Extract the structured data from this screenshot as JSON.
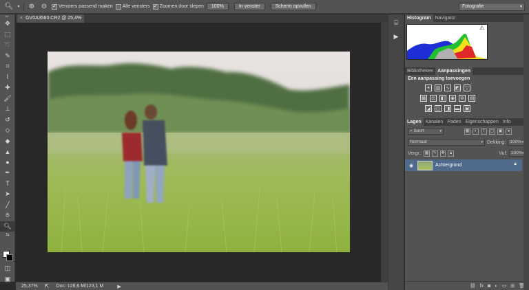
{
  "options_bar": {
    "tool_icons": [
      "zoom-icon",
      "zoom-in-icon",
      "zoom-out-icon"
    ],
    "resize_windows_label": "Vensters passend maken",
    "resize_windows_checked": true,
    "all_windows_label": "Alle vensters",
    "all_windows_checked": false,
    "scrubby_zoom_label": "Zoomen door slepen",
    "scrubby_zoom_checked": true,
    "btn_100": "100%",
    "btn_fit": "In venster",
    "btn_fill": "Scherm opvullen",
    "workspace": "Fotografie"
  },
  "document": {
    "tab_title": "GV0A3560.CR2 @ 25,4%",
    "close_glyph": "×"
  },
  "status": {
    "zoom": "25,37%",
    "doc_info": "Doc: 126,6 M/123,1 M"
  },
  "panels": {
    "histogram_tab": "Histogram",
    "navigator_tab": "Navigator",
    "libraries_tab": "Bibliotheken",
    "adjustments_tab": "Aanpassingen",
    "adjustments_title": "Een aanpassing toevoegen",
    "layers_tab": "Lagen",
    "channels_tab": "Kanalen",
    "paths_tab": "Paden",
    "properties_tab": "Eigenschappen",
    "info_tab": "Info",
    "filter_kind": "Soort",
    "blend_mode": "Normaal",
    "opacity_label": "Dekking:",
    "opacity_value": "100%",
    "lock_label": "Vergr.:",
    "fill_label": "Vul:",
    "fill_value": "100%",
    "layer_name": "Achtergrond"
  },
  "colors": {
    "accent_selected_layer": "#4f6a8a",
    "ui_panel": "#535353",
    "canvas_bg": "#282828"
  }
}
